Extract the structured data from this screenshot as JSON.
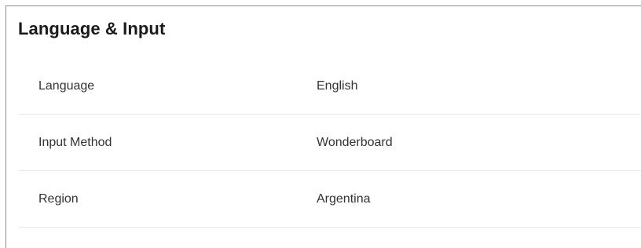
{
  "section": {
    "title": "Language & Input"
  },
  "settings": [
    {
      "label": "Language",
      "value": "English"
    },
    {
      "label": "Input Method",
      "value": "Wonderboard"
    },
    {
      "label": "Region",
      "value": "Argentina"
    }
  ]
}
